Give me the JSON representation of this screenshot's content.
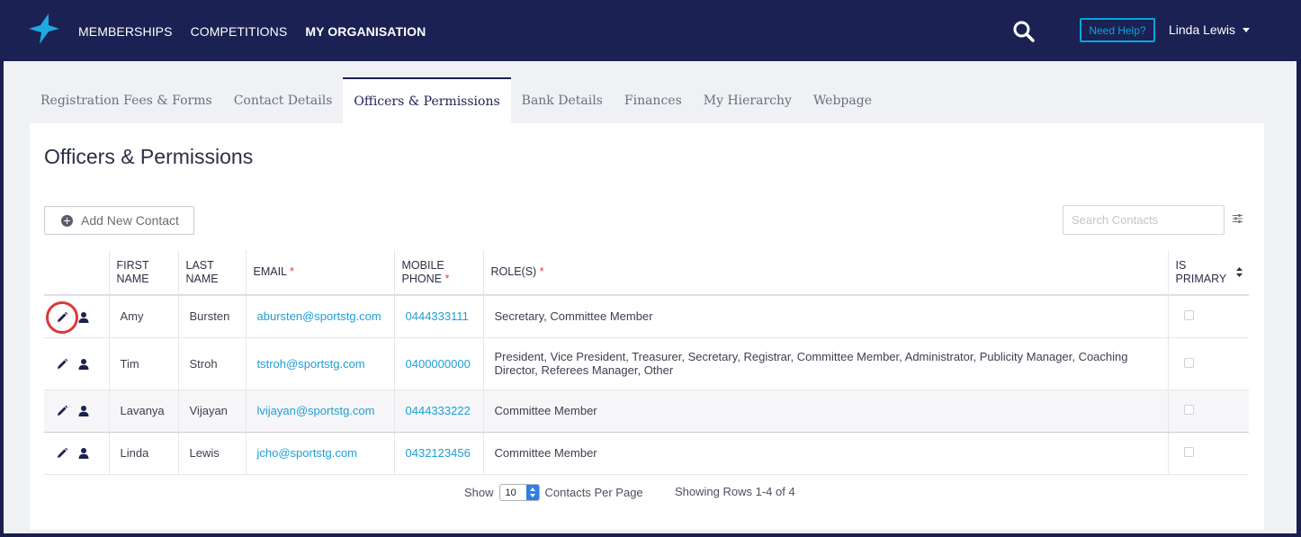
{
  "header": {
    "nav": [
      "MEMBERSHIPS",
      "COMPETITIONS",
      "MY ORGANISATION"
    ],
    "active_nav": 2,
    "help_label": "Need Help?",
    "user_name": "Linda Lewis"
  },
  "tabs": [
    "Registration Fees & Forms",
    "Contact Details",
    "Officers & Permissions",
    "Bank Details",
    "Finances",
    "My Hierarchy",
    "Webpage"
  ],
  "active_tab": 2,
  "page": {
    "title": "Officers & Permissions",
    "add_button": "Add New Contact",
    "search_placeholder": "Search Contacts"
  },
  "table": {
    "headers": {
      "first_name": [
        "FIRST",
        "NAME"
      ],
      "last_name": [
        "LAST",
        "NAME"
      ],
      "email": "EMAIL",
      "mobile": [
        "MOBILE",
        "PHONE"
      ],
      "roles": "ROLE(S)",
      "primary": [
        "IS",
        "PRIMARY"
      ],
      "required_mark": "*"
    },
    "rows": [
      {
        "first": "Amy",
        "last": "Bursten",
        "email": "abursten@sportstg.com",
        "mobile": "0444333111",
        "roles": "Secretary, Committee Member",
        "primary": false
      },
      {
        "first": "Tim",
        "last": "Stroh",
        "email": "tstroh@sportstg.com",
        "mobile": "0400000000",
        "roles": "President, Vice President, Treasurer, Secretary, Registrar, Committee Member, Administrator, Publicity Manager, Coaching Director, Referees Manager, Other",
        "primary": false
      },
      {
        "first": "Lavanya",
        "last": "Vijayan",
        "email": "lvijayan@sportstg.com",
        "mobile": "0444333222",
        "roles": "Committee Member",
        "primary": false
      },
      {
        "first": "Linda",
        "last": "Lewis",
        "email": "jcho@sportstg.com",
        "mobile": "0432123456",
        "roles": "Committee Member",
        "primary": false
      }
    ]
  },
  "footer": {
    "show_label": "Show",
    "per_page": "10",
    "per_page_label": "Contacts Per Page",
    "showing": "Showing Rows 1-4 of 4"
  },
  "colors": {
    "header_bg": "#1c2153",
    "accent": "#00a9e0",
    "link": "#1d9fd6",
    "highlight_ring": "#d93a3a"
  }
}
